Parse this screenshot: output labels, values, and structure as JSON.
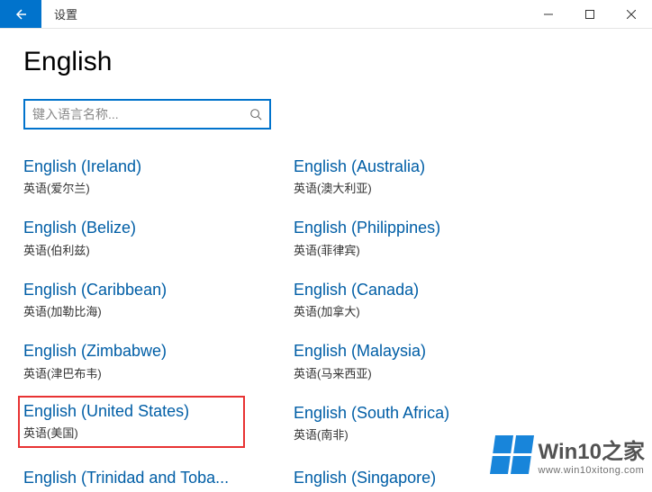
{
  "window": {
    "title": "设置"
  },
  "page": {
    "title": "English"
  },
  "search": {
    "placeholder": "键入语言名称..."
  },
  "languages": [
    {
      "title": "English (Ireland)",
      "sub": "英语(爱尔兰)"
    },
    {
      "title": "English (Australia)",
      "sub": "英语(澳大利亚)"
    },
    {
      "title": "English (Belize)",
      "sub": "英语(伯利兹)"
    },
    {
      "title": "English (Philippines)",
      "sub": "英语(菲律宾)"
    },
    {
      "title": "English (Caribbean)",
      "sub": "英语(加勒比海)"
    },
    {
      "title": "English (Canada)",
      "sub": "英语(加拿大)"
    },
    {
      "title": "English (Zimbabwe)",
      "sub": "英语(津巴布韦)"
    },
    {
      "title": "English (Malaysia)",
      "sub": "英语(马来西亚)"
    },
    {
      "title": "English (United States)",
      "sub": "英语(美国)",
      "highlight": true
    },
    {
      "title": "English (South Africa)",
      "sub": "英语(南非)"
    },
    {
      "title": "English (Trinidad and Toba...",
      "sub": ""
    },
    {
      "title": "English (Singapore)",
      "sub": ""
    }
  ],
  "watermark": {
    "main": "Win10之家",
    "sub": "www.win10xitong.com"
  }
}
